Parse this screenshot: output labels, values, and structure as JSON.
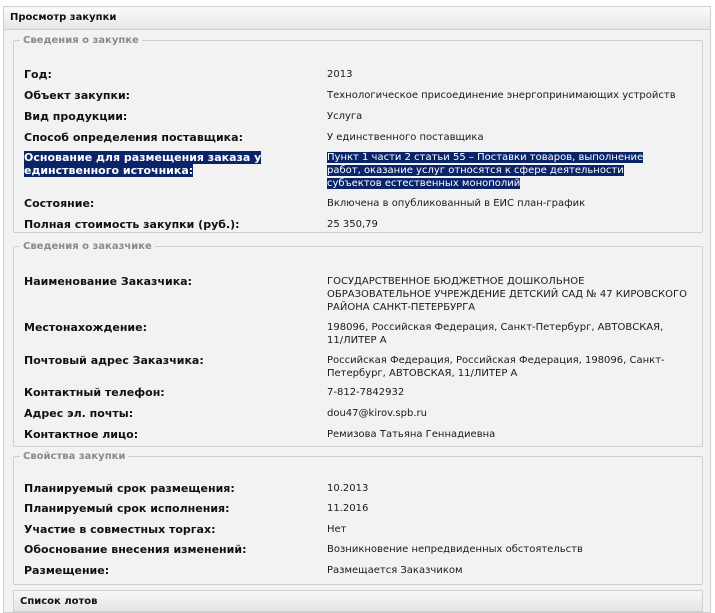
{
  "window": {
    "title": "Просмотр закупки"
  },
  "purchase_info": {
    "legend": "Сведения о закупке",
    "year_label": "Год:",
    "year_value": "2013",
    "object_label": "Объект закупки:",
    "object_value": "Технологическое присоединение энергопринимающих устройств",
    "product_type_label": "Вид продукции:",
    "product_type_value": "Услуга",
    "method_label": "Способ определения поставщика:",
    "method_value": "У единственного поставщика",
    "basis_label": "Основание для размещения заказа у единственного источника:",
    "basis_value": "Пункт 1 части 2 статьи 55 – Поставки товаров, выполнение работ, оказание услуг относятся к сфере деятельности субъектов естественных монополий",
    "status_label": "Состояние:",
    "status_value": "Включена в опубликованный в ЕИС план-график",
    "cost_label": "Полная стоимость закупки (руб.):",
    "cost_value": "25 350,79"
  },
  "customer_info": {
    "legend": "Сведения о заказчике",
    "name_label": "Наименование Заказчика:",
    "name_value": "ГОСУДАРСТВЕННОЕ БЮДЖЕТНОЕ ДОШКОЛЬНОЕ ОБРАЗОВАТЕЛЬНОЕ УЧРЕЖДЕНИЕ ДЕТСКИЙ САД № 47 КИРОВСКОГО РАЙОНА САНКТ-ПЕТЕРБУРГА",
    "location_label": "Местонахождение:",
    "location_value": "198096, Российская Федерация, Санкт-Петербург, АВТОВСКАЯ, 11/ЛИТЕР А",
    "postal_label": "Почтовый адрес Заказчика:",
    "postal_value": "Российская Федерация, Российская Федерация, 198096, Санкт-Петербург, АВТОВСКАЯ, 11/ЛИТЕР А",
    "phone_label": "Контактный телефон:",
    "phone_value": "7-812-7842932",
    "email_label": "Адрес эл. почты:",
    "email_value": "dou47@kirov.spb.ru",
    "contact_label": "Контактное лицо:",
    "contact_value": "Ремизова Татьяна Геннадиевна"
  },
  "properties": {
    "legend": "Свойства закупки",
    "placement_term_label": "Планируемый срок размещения:",
    "placement_term_value": "10.2013",
    "execution_term_label": "Планируемый срок исполнения:",
    "execution_term_value": "11.2016",
    "joint_label": "Участие в совместных торгах:",
    "joint_value": "Нет",
    "changes_label": "Обоснование внесения изменений:",
    "changes_value": "Возникновение непредвиденных обстоятельств",
    "placement_label": "Размещение:",
    "placement_value": "Размещается Заказчиком"
  },
  "lots": {
    "title": "Список лотов"
  },
  "colors": {
    "selection_bg": "#0a246a",
    "selection_text": "#ffffff",
    "panel_bg": "#f2f2f2"
  }
}
